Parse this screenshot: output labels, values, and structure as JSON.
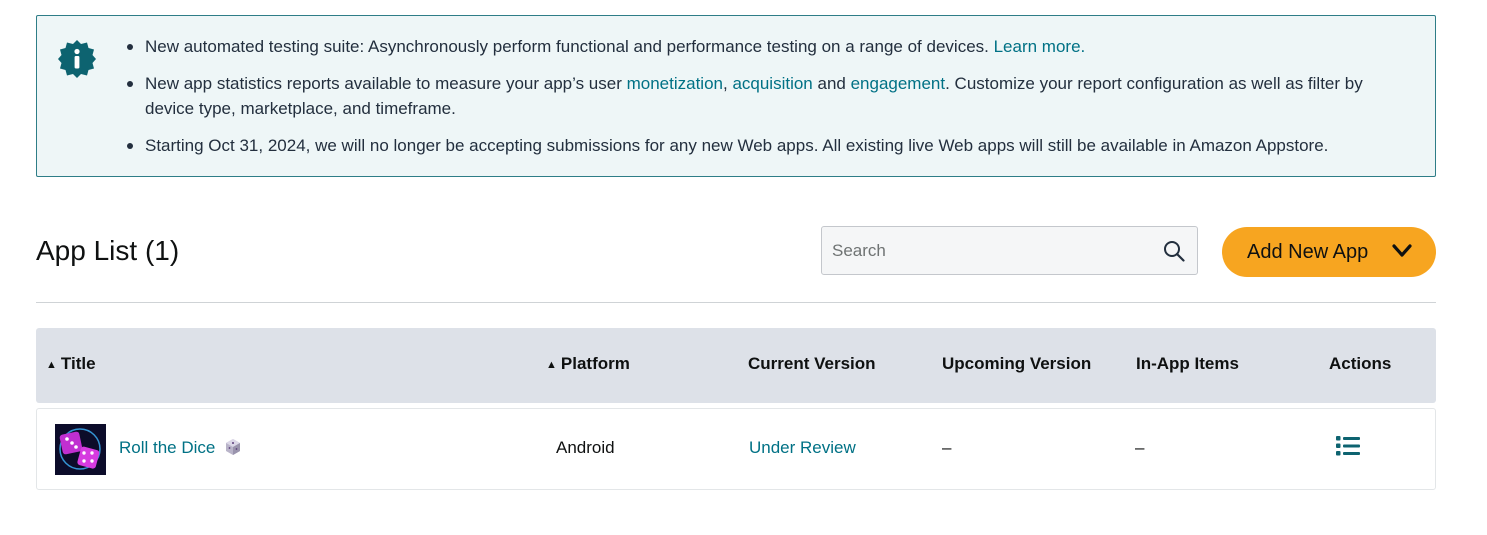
{
  "banner": {
    "item1": {
      "text": "New automated testing suite: Asynchronously perform functional and performance testing on a range of devices. ",
      "link": "Learn more."
    },
    "item2": {
      "text_a": "New app statistics reports available to measure your app’s user ",
      "link_monetization": "monetization",
      "sep1": ", ",
      "link_acquisition": "acquisition",
      "sep2": " and ",
      "link_engagement": "engagement",
      "text_b": ". Customize your report configuration as well as filter by device type, marketplace, and timeframe."
    },
    "item3": {
      "text": "Starting Oct 31, 2024, we will no longer be accepting submissions for any new Web apps. All existing live Web apps will still be available in Amazon Appstore."
    }
  },
  "app_list": {
    "title": "App List (1)",
    "search_placeholder": "Search",
    "add_button": "Add New App"
  },
  "table": {
    "headers": {
      "title": "Title",
      "platform": "Platform",
      "current_version": "Current Version",
      "upcoming_version": "Upcoming Version",
      "in_app_items": "In-App Items",
      "actions": "Actions"
    },
    "rows": [
      {
        "title": "Roll the Dice",
        "platform": "Android",
        "current_version": "Under Review",
        "upcoming_version": "–",
        "in_app_items": "–"
      }
    ]
  },
  "colors": {
    "banner_bg": "#eef6f7",
    "banner_border": "#2e7d87",
    "link": "#007185",
    "accent_button": "#f7a520",
    "table_header_bg": "#dde1e8"
  },
  "icons": [
    "info-badge-icon",
    "search-icon",
    "chevron-down-icon",
    "sort-icon",
    "app-thumbnail",
    "dice-emoji-icon",
    "actions-list-icon"
  ]
}
